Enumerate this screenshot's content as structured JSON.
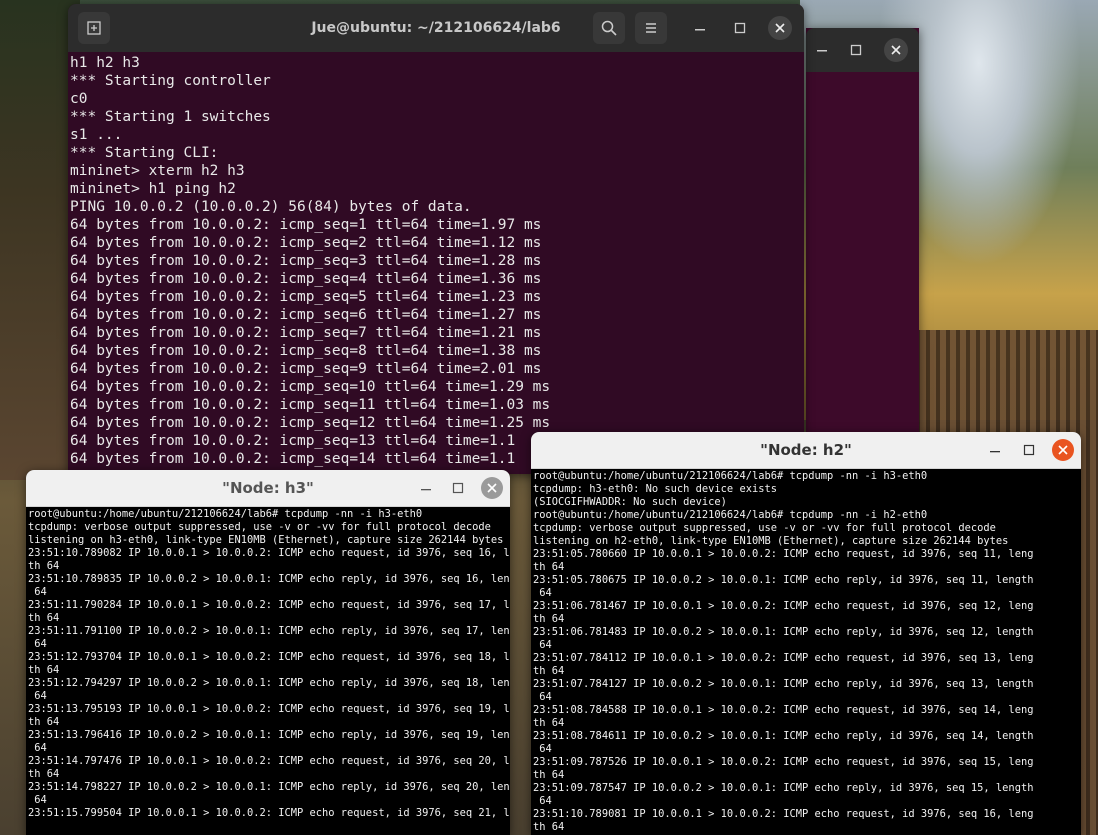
{
  "colors": {
    "terminal_bg": "#300a24",
    "titlebar_dark": "#2c2c2c",
    "xterm_bg": "#000000",
    "close_orange": "#e95420"
  },
  "main_window": {
    "title": "Jue@ubuntu: ~/212106624/lab6",
    "icons": {
      "new_tab": "new-tab-icon",
      "search": "search-icon",
      "menu": "hamburger-menu-icon",
      "minimize": "minimize-icon",
      "maximize": "maximize-icon",
      "close": "close-icon"
    },
    "lines": [
      "h1 h2 h3",
      "*** Starting controller",
      "c0",
      "*** Starting 1 switches",
      "s1 ...",
      "*** Starting CLI:",
      "mininet> xterm h2 h3",
      "mininet> h1 ping h2",
      "PING 10.0.0.2 (10.0.0.2) 56(84) bytes of data.",
      "64 bytes from 10.0.0.2: icmp_seq=1 ttl=64 time=1.97 ms",
      "64 bytes from 10.0.0.2: icmp_seq=2 ttl=64 time=1.12 ms",
      "64 bytes from 10.0.0.2: icmp_seq=3 ttl=64 time=1.28 ms",
      "64 bytes from 10.0.0.2: icmp_seq=4 ttl=64 time=1.36 ms",
      "64 bytes from 10.0.0.2: icmp_seq=5 ttl=64 time=1.23 ms",
      "64 bytes from 10.0.0.2: icmp_seq=6 ttl=64 time=1.27 ms",
      "64 bytes from 10.0.0.2: icmp_seq=7 ttl=64 time=1.21 ms",
      "64 bytes from 10.0.0.2: icmp_seq=8 ttl=64 time=1.38 ms",
      "64 bytes from 10.0.0.2: icmp_seq=9 ttl=64 time=2.01 ms",
      "64 bytes from 10.0.0.2: icmp_seq=10 ttl=64 time=1.29 ms",
      "64 bytes from 10.0.0.2: icmp_seq=11 ttl=64 time=1.03 ms",
      "64 bytes from 10.0.0.2: icmp_seq=12 ttl=64 time=1.25 ms",
      "64 bytes from 10.0.0.2: icmp_seq=13 ttl=64 time=1.1",
      "64 bytes from 10.0.0.2: icmp_seq=14 ttl=64 time=1.1"
    ]
  },
  "h3_window": {
    "title": "\"Node: h3\"",
    "lines": [
      "root@ubuntu:/home/ubuntu/212106624/lab6# tcpdump -nn -i h3-eth0",
      "tcpdump: verbose output suppressed, use -v or -vv for full protocol decode",
      "listening on h3-eth0, link-type EN10MB (Ethernet), capture size 262144 bytes",
      "23:51:10.789082 IP 10.0.0.1 > 10.0.0.2: ICMP echo request, id 3976, seq 16, leng",
      "th 64",
      "23:51:10.789835 IP 10.0.0.2 > 10.0.0.1: ICMP echo reply, id 3976, seq 16, length",
      " 64",
      "23:51:11.790284 IP 10.0.0.1 > 10.0.0.2: ICMP echo request, id 3976, seq 17, leng",
      "th 64",
      "23:51:11.791100 IP 10.0.0.2 > 10.0.0.1: ICMP echo reply, id 3976, seq 17, length",
      " 64",
      "23:51:12.793704 IP 10.0.0.1 > 10.0.0.2: ICMP echo request, id 3976, seq 18, leng",
      "th 64",
      "23:51:12.794297 IP 10.0.0.2 > 10.0.0.1: ICMP echo reply, id 3976, seq 18, length",
      " 64",
      "23:51:13.795193 IP 10.0.0.1 > 10.0.0.2: ICMP echo request, id 3976, seq 19, leng",
      "th 64",
      "23:51:13.796416 IP 10.0.0.2 > 10.0.0.1: ICMP echo reply, id 3976, seq 19, length",
      " 64",
      "23:51:14.797476 IP 10.0.0.1 > 10.0.0.2: ICMP echo request, id 3976, seq 20, leng",
      "th 64",
      "23:51:14.798227 IP 10.0.0.2 > 10.0.0.1: ICMP echo reply, id 3976, seq 20, length",
      " 64",
      "23:51:15.799504 IP 10.0.0.1 > 10.0.0.2: ICMP echo request, id 3976, seq 21, leng"
    ]
  },
  "h2_window": {
    "title": "\"Node: h2\"",
    "lines": [
      "root@ubuntu:/home/ubuntu/212106624/lab6# tcpdump -nn -i h3-eth0",
      "tcpdump: h3-eth0: No such device exists",
      "(SIOCGIFHWADDR: No such device)",
      "root@ubuntu:/home/ubuntu/212106624/lab6# tcpdump -nn -i h2-eth0",
      "tcpdump: verbose output suppressed, use -v or -vv for full protocol decode",
      "listening on h2-eth0, link-type EN10MB (Ethernet), capture size 262144 bytes",
      "23:51:05.780660 IP 10.0.0.1 > 10.0.0.2: ICMP echo request, id 3976, seq 11, leng",
      "th 64",
      "23:51:05.780675 IP 10.0.0.2 > 10.0.0.1: ICMP echo reply, id 3976, seq 11, length",
      " 64",
      "23:51:06.781467 IP 10.0.0.1 > 10.0.0.2: ICMP echo request, id 3976, seq 12, leng",
      "th 64",
      "23:51:06.781483 IP 10.0.0.2 > 10.0.0.1: ICMP echo reply, id 3976, seq 12, length",
      " 64",
      "23:51:07.784112 IP 10.0.0.1 > 10.0.0.2: ICMP echo request, id 3976, seq 13, leng",
      "th 64",
      "23:51:07.784127 IP 10.0.0.2 > 10.0.0.1: ICMP echo reply, id 3976, seq 13, length",
      " 64",
      "23:51:08.784588 IP 10.0.0.1 > 10.0.0.2: ICMP echo request, id 3976, seq 14, leng",
      "th 64",
      "23:51:08.784611 IP 10.0.0.2 > 10.0.0.1: ICMP echo reply, id 3976, seq 14, length",
      " 64",
      "23:51:09.787526 IP 10.0.0.1 > 10.0.0.2: ICMP echo request, id 3976, seq 15, leng",
      "th 64",
      "23:51:09.787547 IP 10.0.0.2 > 10.0.0.1: ICMP echo reply, id 3976, seq 15, length",
      " 64",
      "23:51:10.789081 IP 10.0.0.1 > 10.0.0.2: ICMP echo request, id 3976, seq 16, leng",
      "th 64"
    ]
  }
}
